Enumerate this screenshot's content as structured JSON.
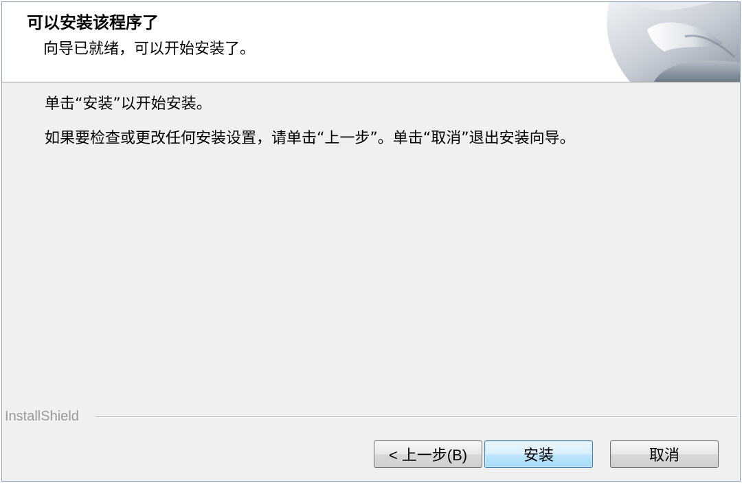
{
  "header": {
    "title": "可以安装该程序了",
    "subtitle": "向导已就绪，可以开始安装了。"
  },
  "body": {
    "line1": "单击“安装”以开始安装。",
    "line2": "如果要检查或更改任何安装设置，请单击“上一步”。单击“取消”退出安装向导。"
  },
  "footer": {
    "brand": "InstallShield"
  },
  "buttons": {
    "back": "< 上一步(B)",
    "install": "安装",
    "cancel": "取消"
  },
  "colors": {
    "dialog_background": "#f0f0f0",
    "default_button_accent": "#3c7fb1"
  },
  "icons": {
    "header_graphic": "installshield-page-curl-graphic"
  }
}
